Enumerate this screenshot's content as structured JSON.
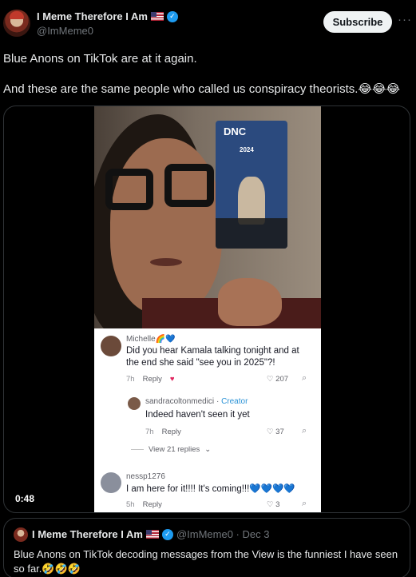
{
  "post": {
    "author_name": "I Meme Therefore I Am",
    "handle": "@ImMeme0",
    "subscribe_label": "Subscribe",
    "more_label": "···",
    "text_line1": "Blue Anons on TikTok are at it again.",
    "text_line2": "And these are the same people who called us conspiracy theorists.😂😂😂"
  },
  "video": {
    "duration": "0:48",
    "screen_text": "DNC",
    "screen_year": "2024",
    "comments": [
      {
        "user": "Michelle🌈💙",
        "text": "Did you hear Kamala talking tonight and at the end she said \"see you in 2025\"?!",
        "age": "7h",
        "reply": "Reply",
        "likes": "207"
      },
      {
        "user": "sandracoltonmedici",
        "badge": "Creator",
        "text": "Indeed haven't seen it yet",
        "age": "7h",
        "reply": "Reply",
        "likes": "37"
      },
      {
        "user": "nessp1276",
        "text": "I am here for it!!!! It's coming!!!💙💙💙💙",
        "age": "5h",
        "reply": "Reply",
        "likes": "3"
      }
    ],
    "view_replies": "View 21 replies"
  },
  "quote": {
    "author_name": "I Meme Therefore I Am",
    "handle_date": "@ImMeme0 · Dec 3",
    "text": "Blue Anons on TikTok decoding messages from the View is the funniest I have seen so far.🤣🤣🤣"
  },
  "colors": {
    "accent": "#1d9bf0",
    "background": "#000000",
    "text": "#e7e9ea",
    "muted": "#71767b"
  }
}
